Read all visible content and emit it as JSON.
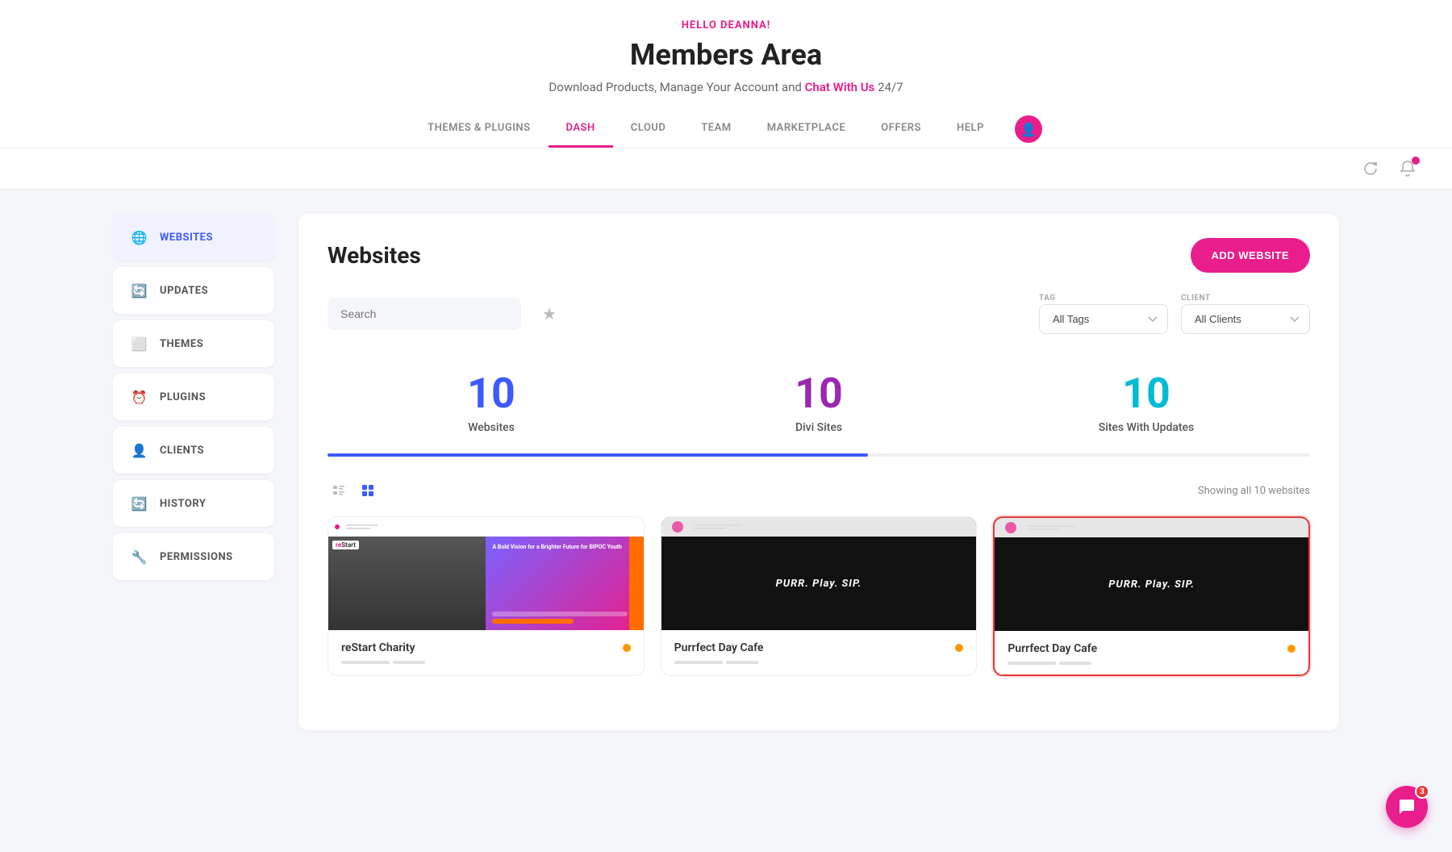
{
  "header": {
    "greeting": "HELLO DEANNA!",
    "title": "Members Area",
    "subtitle_before": "Download Products, Manage Your Account and ",
    "subtitle_link": "Chat With Us",
    "subtitle_after": " 24/7"
  },
  "nav": {
    "items": [
      {
        "label": "THEMES & PLUGINS",
        "active": false
      },
      {
        "label": "DASH",
        "active": true
      },
      {
        "label": "CLOUD",
        "active": false
      },
      {
        "label": "TEAM",
        "active": false
      },
      {
        "label": "MARKETPLACE",
        "active": false
      },
      {
        "label": "OFFERS",
        "active": false
      },
      {
        "label": "HELP",
        "active": false
      }
    ]
  },
  "toolbar": {
    "refresh_label": "↻",
    "notification_count": ""
  },
  "sidebar": {
    "items": [
      {
        "id": "websites",
        "label": "WEBSITES",
        "icon": "🌐",
        "active": true
      },
      {
        "id": "updates",
        "label": "UPDATES",
        "icon": "🔄",
        "active": false
      },
      {
        "id": "themes",
        "label": "THEMES",
        "icon": "⬜",
        "active": false
      },
      {
        "id": "plugins",
        "label": "PLUGINS",
        "icon": "⏰",
        "active": false
      },
      {
        "id": "clients",
        "label": "CLIENTS",
        "icon": "👤",
        "active": false
      },
      {
        "id": "history",
        "label": "HISTORY",
        "icon": "🔄",
        "active": false
      },
      {
        "id": "permissions",
        "label": "PERMISSIONS",
        "icon": "🔧",
        "active": false
      }
    ]
  },
  "content": {
    "title": "Websites",
    "add_button": "ADD WEBSITE",
    "search_placeholder": "Search",
    "tag_label": "TAG",
    "tag_default": "All Tags",
    "client_label": "CLIENT",
    "client_default": "All Clients",
    "stats": [
      {
        "number": "10",
        "label": "Websites",
        "color": "blue"
      },
      {
        "number": "10",
        "label": "Divi Sites",
        "color": "purple"
      },
      {
        "number": "10",
        "label": "Sites With Updates",
        "color": "teal"
      }
    ],
    "showing_text": "Showing all 10 websites",
    "sites": [
      {
        "name": "reStart Charity",
        "type": "restart",
        "dot_color": "#ff9800",
        "highlighted": false
      },
      {
        "name": "Purrfect Day Cafe",
        "type": "purr",
        "dot_color": "#ff9800",
        "highlighted": false
      },
      {
        "name": "Purrfect Day Cafe",
        "type": "purr",
        "dot_color": "#ff9800",
        "highlighted": true
      }
    ],
    "purr_text": "PURR. Play. SIP.",
    "restart_text": "A Bold Vision for a Brighter Future for BIPOC Youth"
  },
  "chat": {
    "badge": "3"
  }
}
